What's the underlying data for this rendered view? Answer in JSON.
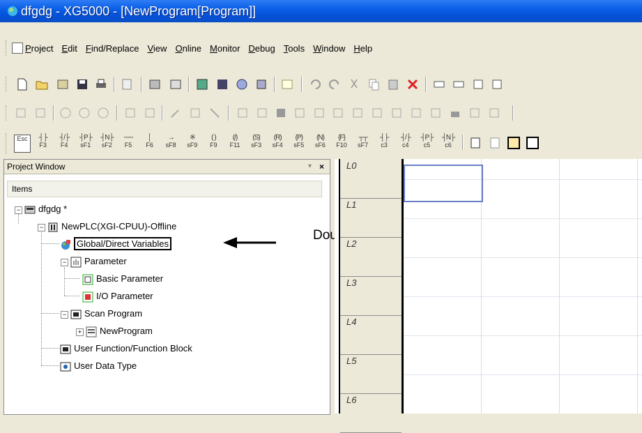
{
  "window": {
    "title": "dfgdg - XG5000 - [NewProgram[Program]]"
  },
  "menu": {
    "items": [
      {
        "label": "Project",
        "underline": "P"
      },
      {
        "label": "Edit",
        "underline": "E"
      },
      {
        "label": "Find/Replace",
        "underline": "F"
      },
      {
        "label": "View",
        "underline": "V"
      },
      {
        "label": "Online",
        "underline": "O"
      },
      {
        "label": "Monitor",
        "underline": "M"
      },
      {
        "label": "Debug",
        "underline": "D"
      },
      {
        "label": "Tools",
        "underline": "T"
      },
      {
        "label": "Window",
        "underline": "W"
      },
      {
        "label": "Help",
        "underline": "H"
      }
    ]
  },
  "ladder_keys": [
    {
      "sym": "",
      "label": "Esc"
    },
    {
      "sym": "┤├",
      "label": "F3"
    },
    {
      "sym": "┤/├",
      "label": "F4"
    },
    {
      "sym": "┤P├",
      "label": "sF1"
    },
    {
      "sym": "┤N├",
      "label": "sF2"
    },
    {
      "sym": "──",
      "label": "F5"
    },
    {
      "sym": "│",
      "label": "F6"
    },
    {
      "sym": "→",
      "label": "sF8"
    },
    {
      "sym": "※",
      "label": "sF9"
    },
    {
      "sym": "( )",
      "label": "F9"
    },
    {
      "sym": "(/)",
      "label": "F11"
    },
    {
      "sym": "(S)",
      "label": "sF3"
    },
    {
      "sym": "(R)",
      "label": "sF4"
    },
    {
      "sym": "(P)",
      "label": "sF5"
    },
    {
      "sym": "(N)",
      "label": "sF6"
    },
    {
      "sym": "{F}",
      "label": "F10"
    },
    {
      "sym": "┬┬",
      "label": "sF7"
    },
    {
      "sym": "┤├",
      "label": "c3"
    },
    {
      "sym": "┤/├",
      "label": "c4"
    },
    {
      "sym": "┤P├",
      "label": "c5"
    },
    {
      "sym": "┤N├",
      "label": "c6"
    }
  ],
  "project_window": {
    "title": "Project Window",
    "pin": "▾",
    "close": "×",
    "column_header": "Items",
    "tree": {
      "root": "dfgdg *",
      "plc": "NewPLC(XGI-CPUU)-Offline",
      "global_vars": "Global/Direct Variables",
      "parameter": "Parameter",
      "basic_param": "Basic Parameter",
      "io_param": "I/O Parameter",
      "scan_program": "Scan Program",
      "new_program": "NewProgram",
      "user_function": "User Function/Function Block",
      "user_data_type": "User Data Type"
    }
  },
  "annotation": {
    "text": "Double-click"
  },
  "ladder": {
    "rows": [
      "L0",
      "L1",
      "L2",
      "L3",
      "L4",
      "L5",
      "L6"
    ]
  }
}
